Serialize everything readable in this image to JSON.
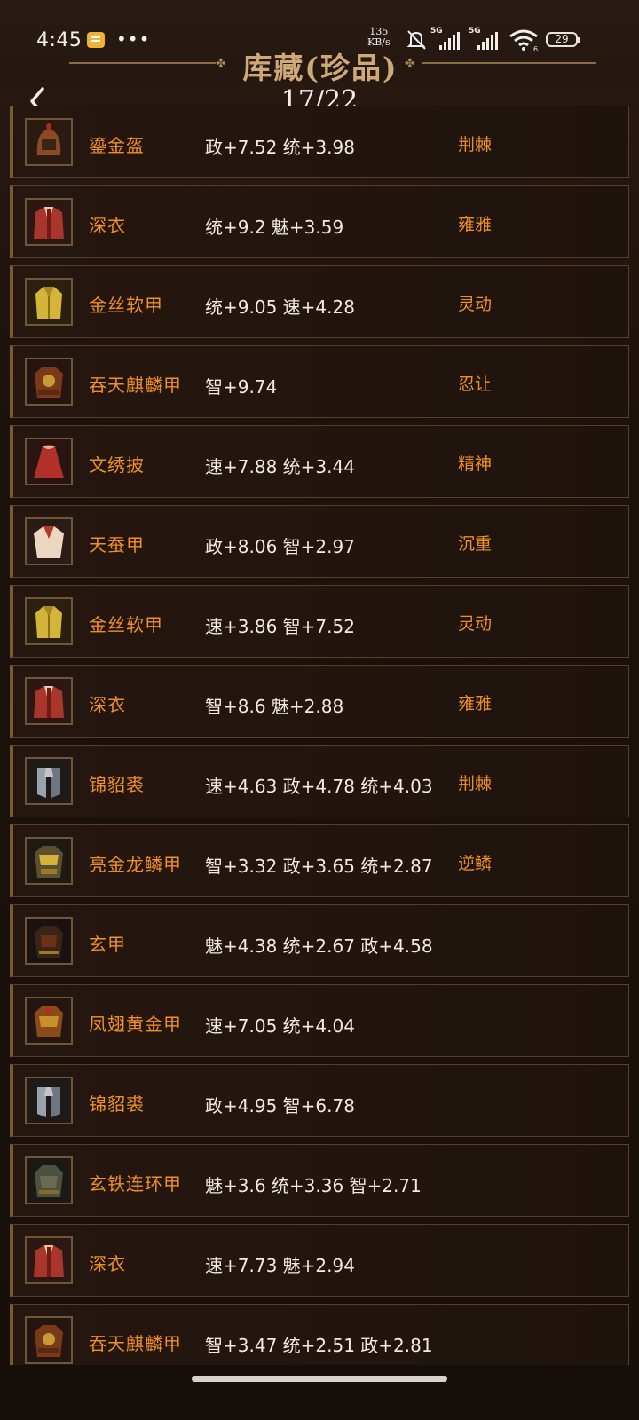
{
  "status_bar": {
    "time": "4:45",
    "net_speed_value": "135",
    "net_speed_unit": "KB/s",
    "sim1_label": "5G",
    "sim2_label": "5G",
    "wifi_sub": "6",
    "battery": "29"
  },
  "header": {
    "title": "库藏(珍品)",
    "page_indicator": "17/22"
  },
  "colors": {
    "accent_orange": "#f08f24",
    "title_gold": "#cfa877"
  },
  "items": [
    {
      "name": "鎏金盔",
      "stats": "政+7.52 统+3.98",
      "trait": "荆棘",
      "icon": "helmet-icon"
    },
    {
      "name": "深衣",
      "stats": "统+9.2 魅+3.59",
      "trait": "雍雅",
      "icon": "robe-icon"
    },
    {
      "name": "金丝软甲",
      "stats": "统+9.05 速+4.28",
      "trait": "灵动",
      "icon": "golden-vest-icon"
    },
    {
      "name": "吞天麒麟甲",
      "stats": "智+9.74",
      "trait": "忍让",
      "icon": "qilin-armor-icon"
    },
    {
      "name": "文绣披",
      "stats": "速+7.88 统+3.44",
      "trait": "精神",
      "icon": "cape-icon"
    },
    {
      "name": "天蚕甲",
      "stats": "政+8.06 智+2.97",
      "trait": "沉重",
      "icon": "silk-armor-icon"
    },
    {
      "name": "金丝软甲",
      "stats": "速+3.86 智+7.52",
      "trait": "灵动",
      "icon": "golden-vest-icon"
    },
    {
      "name": "深衣",
      "stats": "智+8.6 魅+2.88",
      "trait": "雍雅",
      "icon": "robe-icon"
    },
    {
      "name": "锦貂裘",
      "stats": "速+4.63 政+4.78 统+4.03",
      "trait": "荆棘",
      "icon": "fur-coat-icon"
    },
    {
      "name": "亮金龙鳞甲",
      "stats": "智+3.32 政+3.65 统+2.87",
      "trait": "逆鳞",
      "icon": "dragon-scale-armor-icon"
    },
    {
      "name": "玄甲",
      "stats": "魅+4.38 统+2.67 政+4.58",
      "trait": "",
      "icon": "dark-armor-icon"
    },
    {
      "name": "凤翅黄金甲",
      "stats": "速+7.05 统+4.04",
      "trait": "",
      "icon": "phoenix-armor-icon"
    },
    {
      "name": "锦貂裘",
      "stats": "政+4.95 智+6.78",
      "trait": "",
      "icon": "fur-coat-icon"
    },
    {
      "name": "玄铁连环甲",
      "stats": "魅+3.6 统+3.36 智+2.71",
      "trait": "",
      "icon": "chainmail-icon"
    },
    {
      "name": "深衣",
      "stats": "速+7.73 魅+2.94",
      "trait": "",
      "icon": "robe-icon"
    },
    {
      "name": "吞天麒麟甲",
      "stats": "智+3.47 统+2.51 政+2.81",
      "trait": "",
      "icon": "qilin-armor-icon"
    }
  ]
}
